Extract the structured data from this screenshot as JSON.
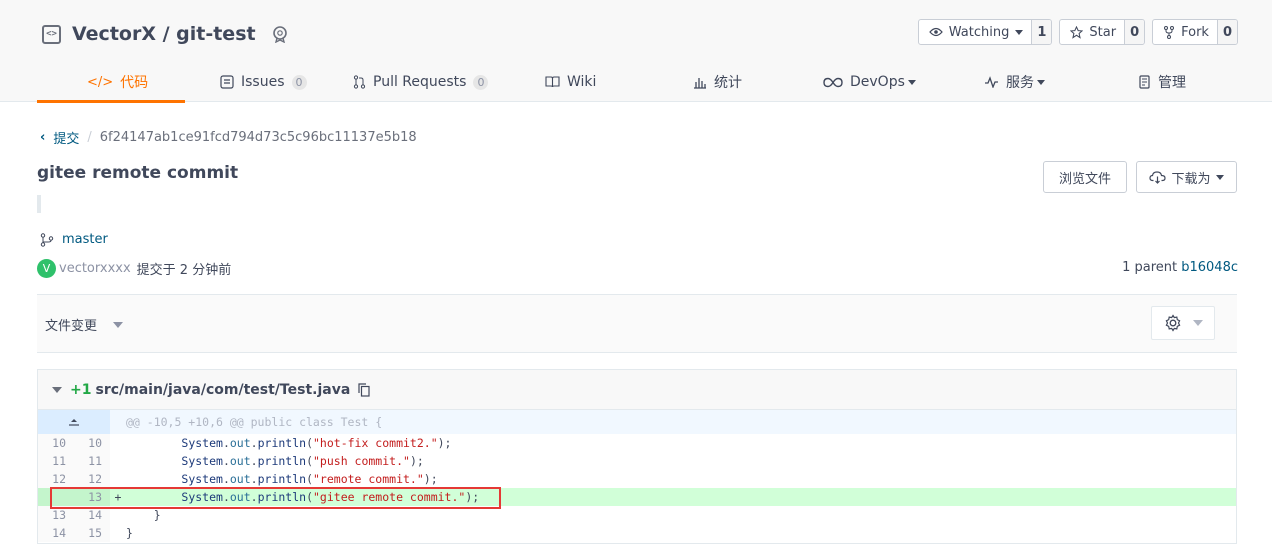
{
  "repo": {
    "name": "VectorX / git-test"
  },
  "actions": [
    {
      "label": "Watching",
      "count": "1"
    },
    {
      "label": "Star",
      "count": "0"
    },
    {
      "label": "Fork",
      "count": "0"
    }
  ],
  "tabs": [
    {
      "label": "代码",
      "active": true
    },
    {
      "label": "Issues",
      "count": "0"
    },
    {
      "label": "Pull Requests",
      "count": "0"
    },
    {
      "label": "Wiki"
    },
    {
      "label": "统计"
    },
    {
      "label": "DevOps"
    },
    {
      "label": "服务"
    },
    {
      "label": "管理"
    }
  ],
  "breadcrumb": {
    "parent": "提交",
    "sep": "/",
    "hash": "6f24147ab1ce91fcd794d73c5c96bc11137e5b18"
  },
  "commit": {
    "title": "gitee remote commit",
    "branch": "master",
    "author_initial": "V",
    "author": "vectorxxxx",
    "time_text": "提交于 2 分钟前",
    "parent_label": "1 parent",
    "parent_hash": "b16048c"
  },
  "buttons": {
    "browse": "浏览文件",
    "download": "下载为"
  },
  "file_changes": {
    "label": "文件变更"
  },
  "diff": {
    "added": "+1",
    "path": "src/main/java/com/test/Test.java",
    "hunk": "@@ -10,5 +10,6 @@ public class Test {",
    "lines": [
      {
        "old": "10",
        "new": "10",
        "sign": "",
        "code": "        System.out.println(\"hot-fix commit2.\");"
      },
      {
        "old": "11",
        "new": "11",
        "sign": "",
        "code": "        System.out.println(\"push commit.\");"
      },
      {
        "old": "12",
        "new": "12",
        "sign": "",
        "code": "        System.out.println(\"remote commit.\");"
      },
      {
        "old": "",
        "new": "13",
        "sign": "+",
        "code": "        System.out.println(\"gitee remote commit.\");",
        "added": true
      },
      {
        "old": "13",
        "new": "14",
        "sign": "",
        "code": "    }"
      },
      {
        "old": "14",
        "new": "15",
        "sign": "",
        "code": "}"
      }
    ]
  },
  "colors": {
    "accent": "#fe7300",
    "link": "#005980",
    "added_bg": "#d1ffd8",
    "highlight": "#e53935"
  }
}
